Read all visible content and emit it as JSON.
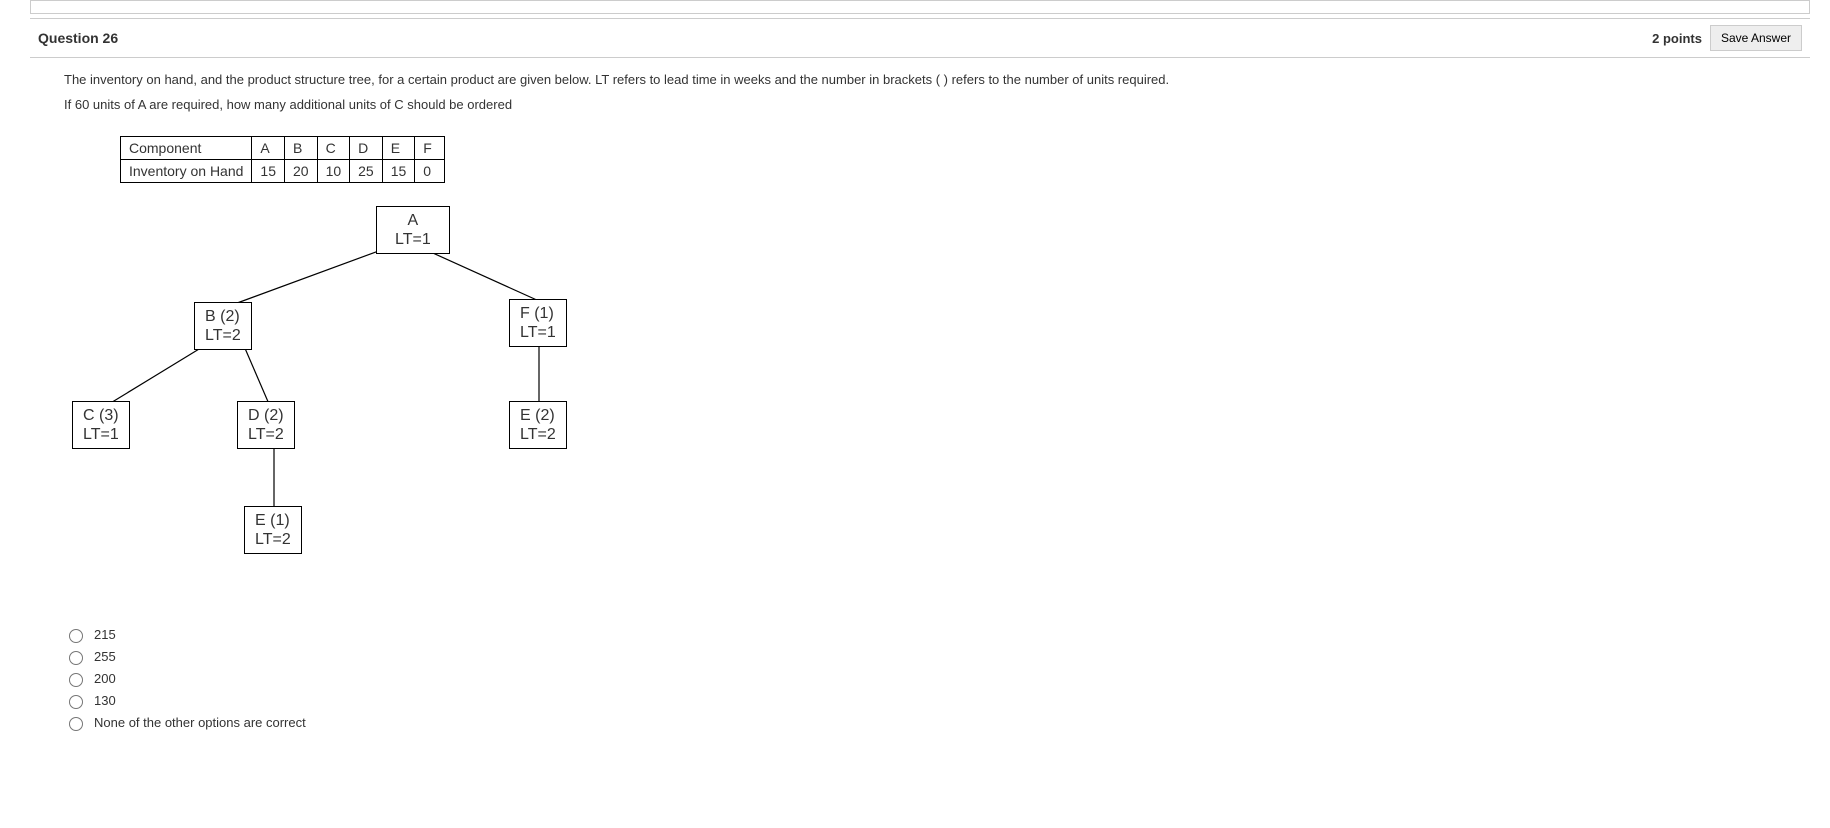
{
  "header": {
    "title": "Question 26",
    "points": "2 points",
    "save": "Save Answer"
  },
  "question": {
    "line1": "The inventory on hand, and the product structure tree, for a certain product are given below. LT refers to lead time in weeks and the number in brackets ( ) refers to the number of units required.",
    "line2": "If 60 units of A are required, how many additional units of C should be ordered"
  },
  "table": {
    "row1": [
      "Component",
      "A",
      "B",
      "C",
      "D",
      "E",
      "F"
    ],
    "row2": [
      "Inventory on Hand",
      "15",
      "20",
      "10",
      "25",
      "15",
      "0"
    ]
  },
  "tree": {
    "A": {
      "line1": "A",
      "line2": "LT=1"
    },
    "B": {
      "line1": "B (2)",
      "line2": "LT=2"
    },
    "F": {
      "line1": "F (1)",
      "line2": "LT=1"
    },
    "C": {
      "line1": "C (3)",
      "line2": "LT=1"
    },
    "D": {
      "line1": "D (2)",
      "line2": "LT=2"
    },
    "E2": {
      "line1": "E (2)",
      "line2": "LT=2"
    },
    "E1": {
      "line1": "E (1)",
      "line2": "LT=2"
    }
  },
  "options": {
    "o1": "215",
    "o2": "255",
    "o3": "200",
    "o4": "130",
    "o5": "None of the other options are correct"
  }
}
